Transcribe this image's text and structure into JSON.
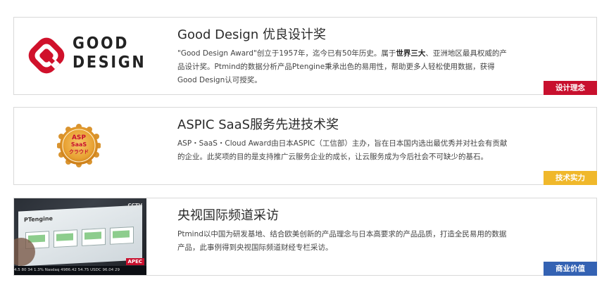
{
  "awards": [
    {
      "title": "Good Design 优良设计奖",
      "desc_prefix": "\"Good Design Award\"创立于1957年，迄今已有50年历史。属于",
      "desc_bold": "世界三大",
      "desc_suffix": "、亚洲地区最具权威的产品设计奖。Ptmind的数据分析产品Ptengine秉承出色的易用性，帮助更多人轻松使用数据，获得Good Design认可授奖。",
      "tag": "设计理念",
      "logo_line1": "GOOD",
      "logo_line2": "DESIGN"
    },
    {
      "title": "ASPIC SaaS服务先进技术奖",
      "desc": "ASP・SaaS・Cloud Award由日本ASPIC（工信部）主办，旨在日本国内选出最优秀并对社会有贡献的企业。此奖项的目的是支持推广云服务企业的成长，让云服务成为今后社会不可缺少的基石。",
      "tag": "技术实力",
      "medal_line1": "ASP",
      "medal_line2": "SaaS",
      "medal_line3": "クラウド"
    },
    {
      "title": "央视国际频道采访",
      "desc": "Ptmind以中国为研发基地、结合欧美创新的产品理念与日本高要求的产品品质，打造全民易用的数据产品，此事例得到央视国际频道财经专栏采访。",
      "tag": "商业价值",
      "tv_product": "PTengine",
      "tv_channel": "CCTV",
      "tv_badge": "APEC",
      "tv_ticker": "4.5 80 34 1.3%   Nasdaq 4986.42 54.75   USDC 96.04 29"
    }
  ],
  "colors": {
    "tag_red": "#c8102e",
    "tag_yellow": "#f0b82b",
    "tag_blue": "#3462b3"
  }
}
